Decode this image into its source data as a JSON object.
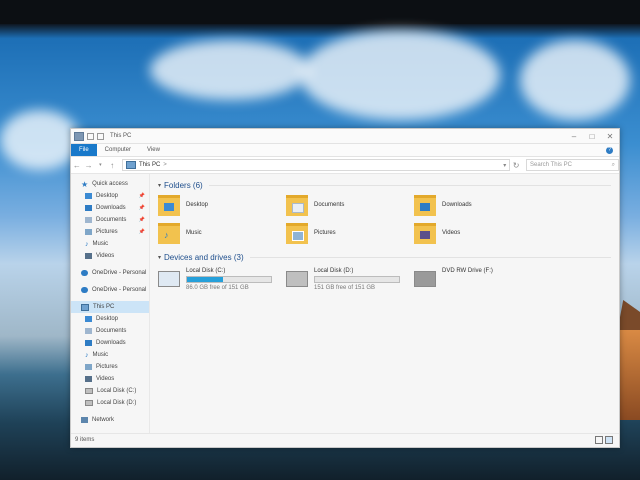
{
  "window": {
    "title": "This PC"
  },
  "ribbon": {
    "tabs": [
      "File",
      "Computer",
      "View"
    ]
  },
  "address": {
    "path": "This PC",
    "separator": ">",
    "search_placeholder": "Search This PC"
  },
  "nav": {
    "quick_access": "Quick access",
    "quick_items": [
      "Desktop",
      "Downloads",
      "Documents",
      "Pictures",
      "Music",
      "Videos"
    ],
    "onedrive_1": "OneDrive - Personal",
    "onedrive_2": "OneDrive - Personal",
    "this_pc": "This PC",
    "pc_items": [
      "Desktop",
      "Documents",
      "Downloads",
      "Music",
      "Pictures",
      "Videos",
      "Local Disk (C:)",
      "Local Disk (D:)"
    ],
    "network": "Network"
  },
  "content": {
    "folders_header": "Folders (6)",
    "folders": [
      "Desktop",
      "Documents",
      "Downloads",
      "Music",
      "Pictures",
      "Videos"
    ],
    "devices_header": "Devices and drives (3)",
    "devices": [
      {
        "name": "Local Disk (C:)",
        "free": "86.0 GB free of 151 GB",
        "used_fraction": 0.43
      },
      {
        "name": "Local Disk (D:)",
        "free": "151 GB free of 151 GB",
        "used_fraction": 0.0
      },
      {
        "name": "DVD RW Drive (F:)",
        "free": ""
      }
    ]
  },
  "status": {
    "items": "9 items"
  },
  "colors": {
    "accent": "#1979ca",
    "selection": "#cce4f7",
    "folder": "#f2c24e",
    "bar": "#26a0da"
  }
}
